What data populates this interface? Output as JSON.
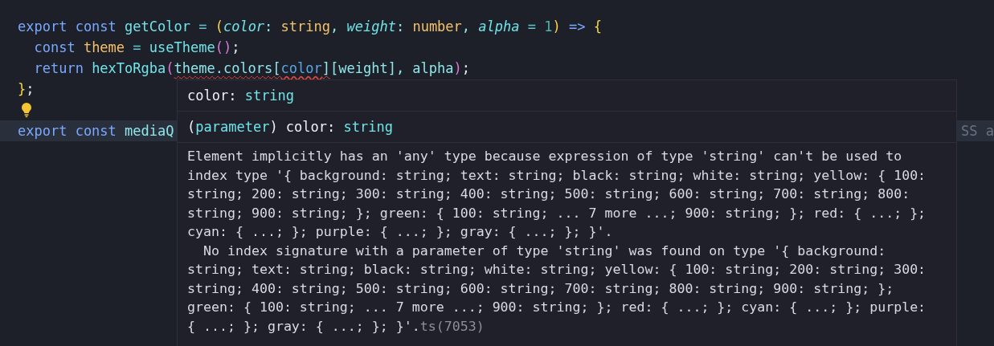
{
  "code_lines": [
    {
      "tokens": [
        {
          "kind": "keyword",
          "text": "export const "
        },
        {
          "kind": "function",
          "text": "getColor "
        },
        {
          "kind": "operator",
          "text": "= "
        },
        {
          "kind": "bracket1",
          "text": "("
        },
        {
          "kind": "param",
          "text": "color"
        },
        {
          "kind": "plain",
          "text": ": "
        },
        {
          "kind": "type",
          "text": "string"
        },
        {
          "kind": "plain",
          "text": ", "
        },
        {
          "kind": "param",
          "text": "weight"
        },
        {
          "kind": "plain",
          "text": ": "
        },
        {
          "kind": "type",
          "text": "number"
        },
        {
          "kind": "plain",
          "text": ", "
        },
        {
          "kind": "param",
          "text": "alpha "
        },
        {
          "kind": "operator",
          "text": "= "
        },
        {
          "kind": "number",
          "text": "1"
        },
        {
          "kind": "bracket1",
          "text": ") "
        },
        {
          "kind": "keyword",
          "text": "=> "
        },
        {
          "kind": "bracket1",
          "text": "{"
        }
      ]
    },
    {
      "tokens": [
        {
          "kind": "keyword",
          "text": "  const "
        },
        {
          "kind": "variable",
          "text": "theme "
        },
        {
          "kind": "operator",
          "text": "= "
        },
        {
          "kind": "function",
          "text": "useTheme"
        },
        {
          "kind": "bracket2",
          "text": "()"
        },
        {
          "kind": "punct",
          "text": ";"
        }
      ]
    },
    {
      "tokens": [
        {
          "kind": "keyword",
          "text": "  return "
        },
        {
          "kind": "function",
          "text": "hexToRgba"
        },
        {
          "kind": "bracket2",
          "text": "("
        },
        {
          "kind": "plain",
          "text": "theme.colors[",
          "squiggle": true
        },
        {
          "kind": "link",
          "text": "color",
          "squiggle": true
        },
        {
          "kind": "plain",
          "text": "]",
          "squiggle": true
        },
        {
          "kind": "plain",
          "text": "[weight], alpha"
        },
        {
          "kind": "bracket2",
          "text": ")"
        },
        {
          "kind": "punct",
          "text": ";"
        }
      ]
    },
    {
      "tokens": [
        {
          "kind": "bracket1",
          "text": "}"
        },
        {
          "kind": "punct",
          "text": ";"
        }
      ]
    },
    {
      "lightbulb": true
    },
    {
      "tokens": [
        {
          "kind": "keyword",
          "text": "export const "
        },
        {
          "kind": "plain",
          "text": "mediaQ"
        }
      ],
      "highlighted": true,
      "trailing": "SS a"
    }
  ],
  "hover": {
    "signature": [
      {
        "kind": "name",
        "text": "color: "
      },
      {
        "kind": "type",
        "text": "string"
      }
    ],
    "declaration": [
      {
        "kind": "name",
        "text": "("
      },
      {
        "kind": "type",
        "text": "parameter"
      },
      {
        "kind": "name",
        "text": ") color: "
      },
      {
        "kind": "type",
        "text": "string"
      }
    ],
    "paragraphs": [
      {
        "lines": [
          "Element implicitly has an 'any' type because expression of type 'string' can't be used to",
          "index type '{ background: string; text: string; black: string; white: string; yellow: { 100:",
          "string; 200: string; 300: string; 400: string; 500: string; 600: string; 700: string; 800:",
          "string; 900: string; }; green: { 100: string; ... 7 more ...; 900: string; }; red: { ...; };",
          "cyan: { ...; }; purple: { ...; }; gray: { ...; }; }'."
        ]
      },
      {
        "lines": [
          "  No index signature with a parameter of type 'string' was found on type '{ background:",
          "string; text: string; black: string; white: string; yellow: { 100: string; 200: string; 300:",
          "string; 400: string; 500: string; 600: string; 700: string; 800: string; 900: string; };",
          "green: { 100: string; ... 7 more ...; 900: string; }; red: { ...; }; cyan: { ...; }; purple:",
          "{ ...; }; gray: { ...; }; }'."
        ],
        "source": "ts(7053)"
      }
    ]
  }
}
